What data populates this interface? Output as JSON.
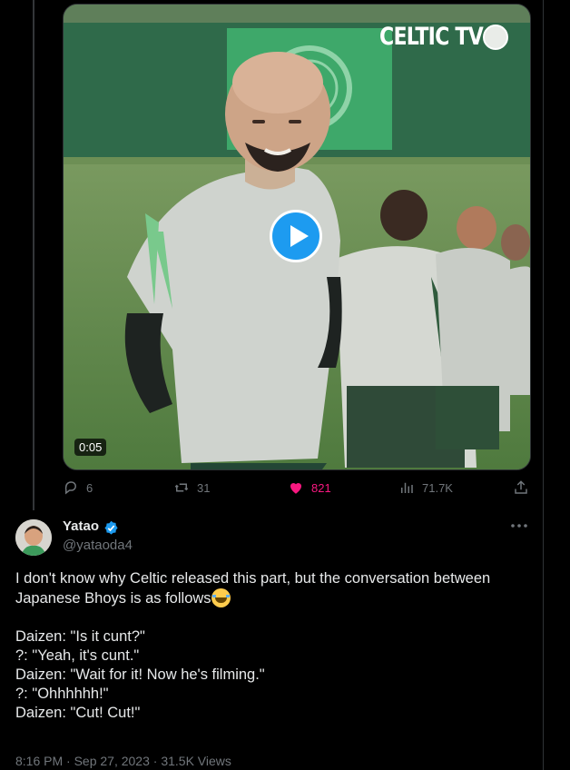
{
  "video": {
    "channel_label": "CELTIC TV",
    "duration": "0:05"
  },
  "actions": {
    "replies": "6",
    "reposts": "31",
    "likes": "821",
    "views": "71.7K"
  },
  "author": {
    "name": "Yatao",
    "handle": "@yataoda4"
  },
  "tweet": {
    "intro": "I don't know why Celtic released this part, but the conversation between Japanese Bhoys is as follows",
    "lines": [
      "Daizen: \"Is it cunt?\"",
      "?: \"Yeah, it's cunt.\"",
      "Daizen: \"Wait for it! Now he's filming.\"",
      "?: \"Ohhhhhh!\"",
      "Daizen: \"Cut! Cut!\""
    ]
  },
  "timestamp_partial": "8:16 PM · Sep 27, 2023 · 31.5K Views",
  "colors": {
    "accent": "#1d9bf0",
    "like": "#f91880",
    "muted": "#71767b",
    "text": "#e7e9ea"
  }
}
